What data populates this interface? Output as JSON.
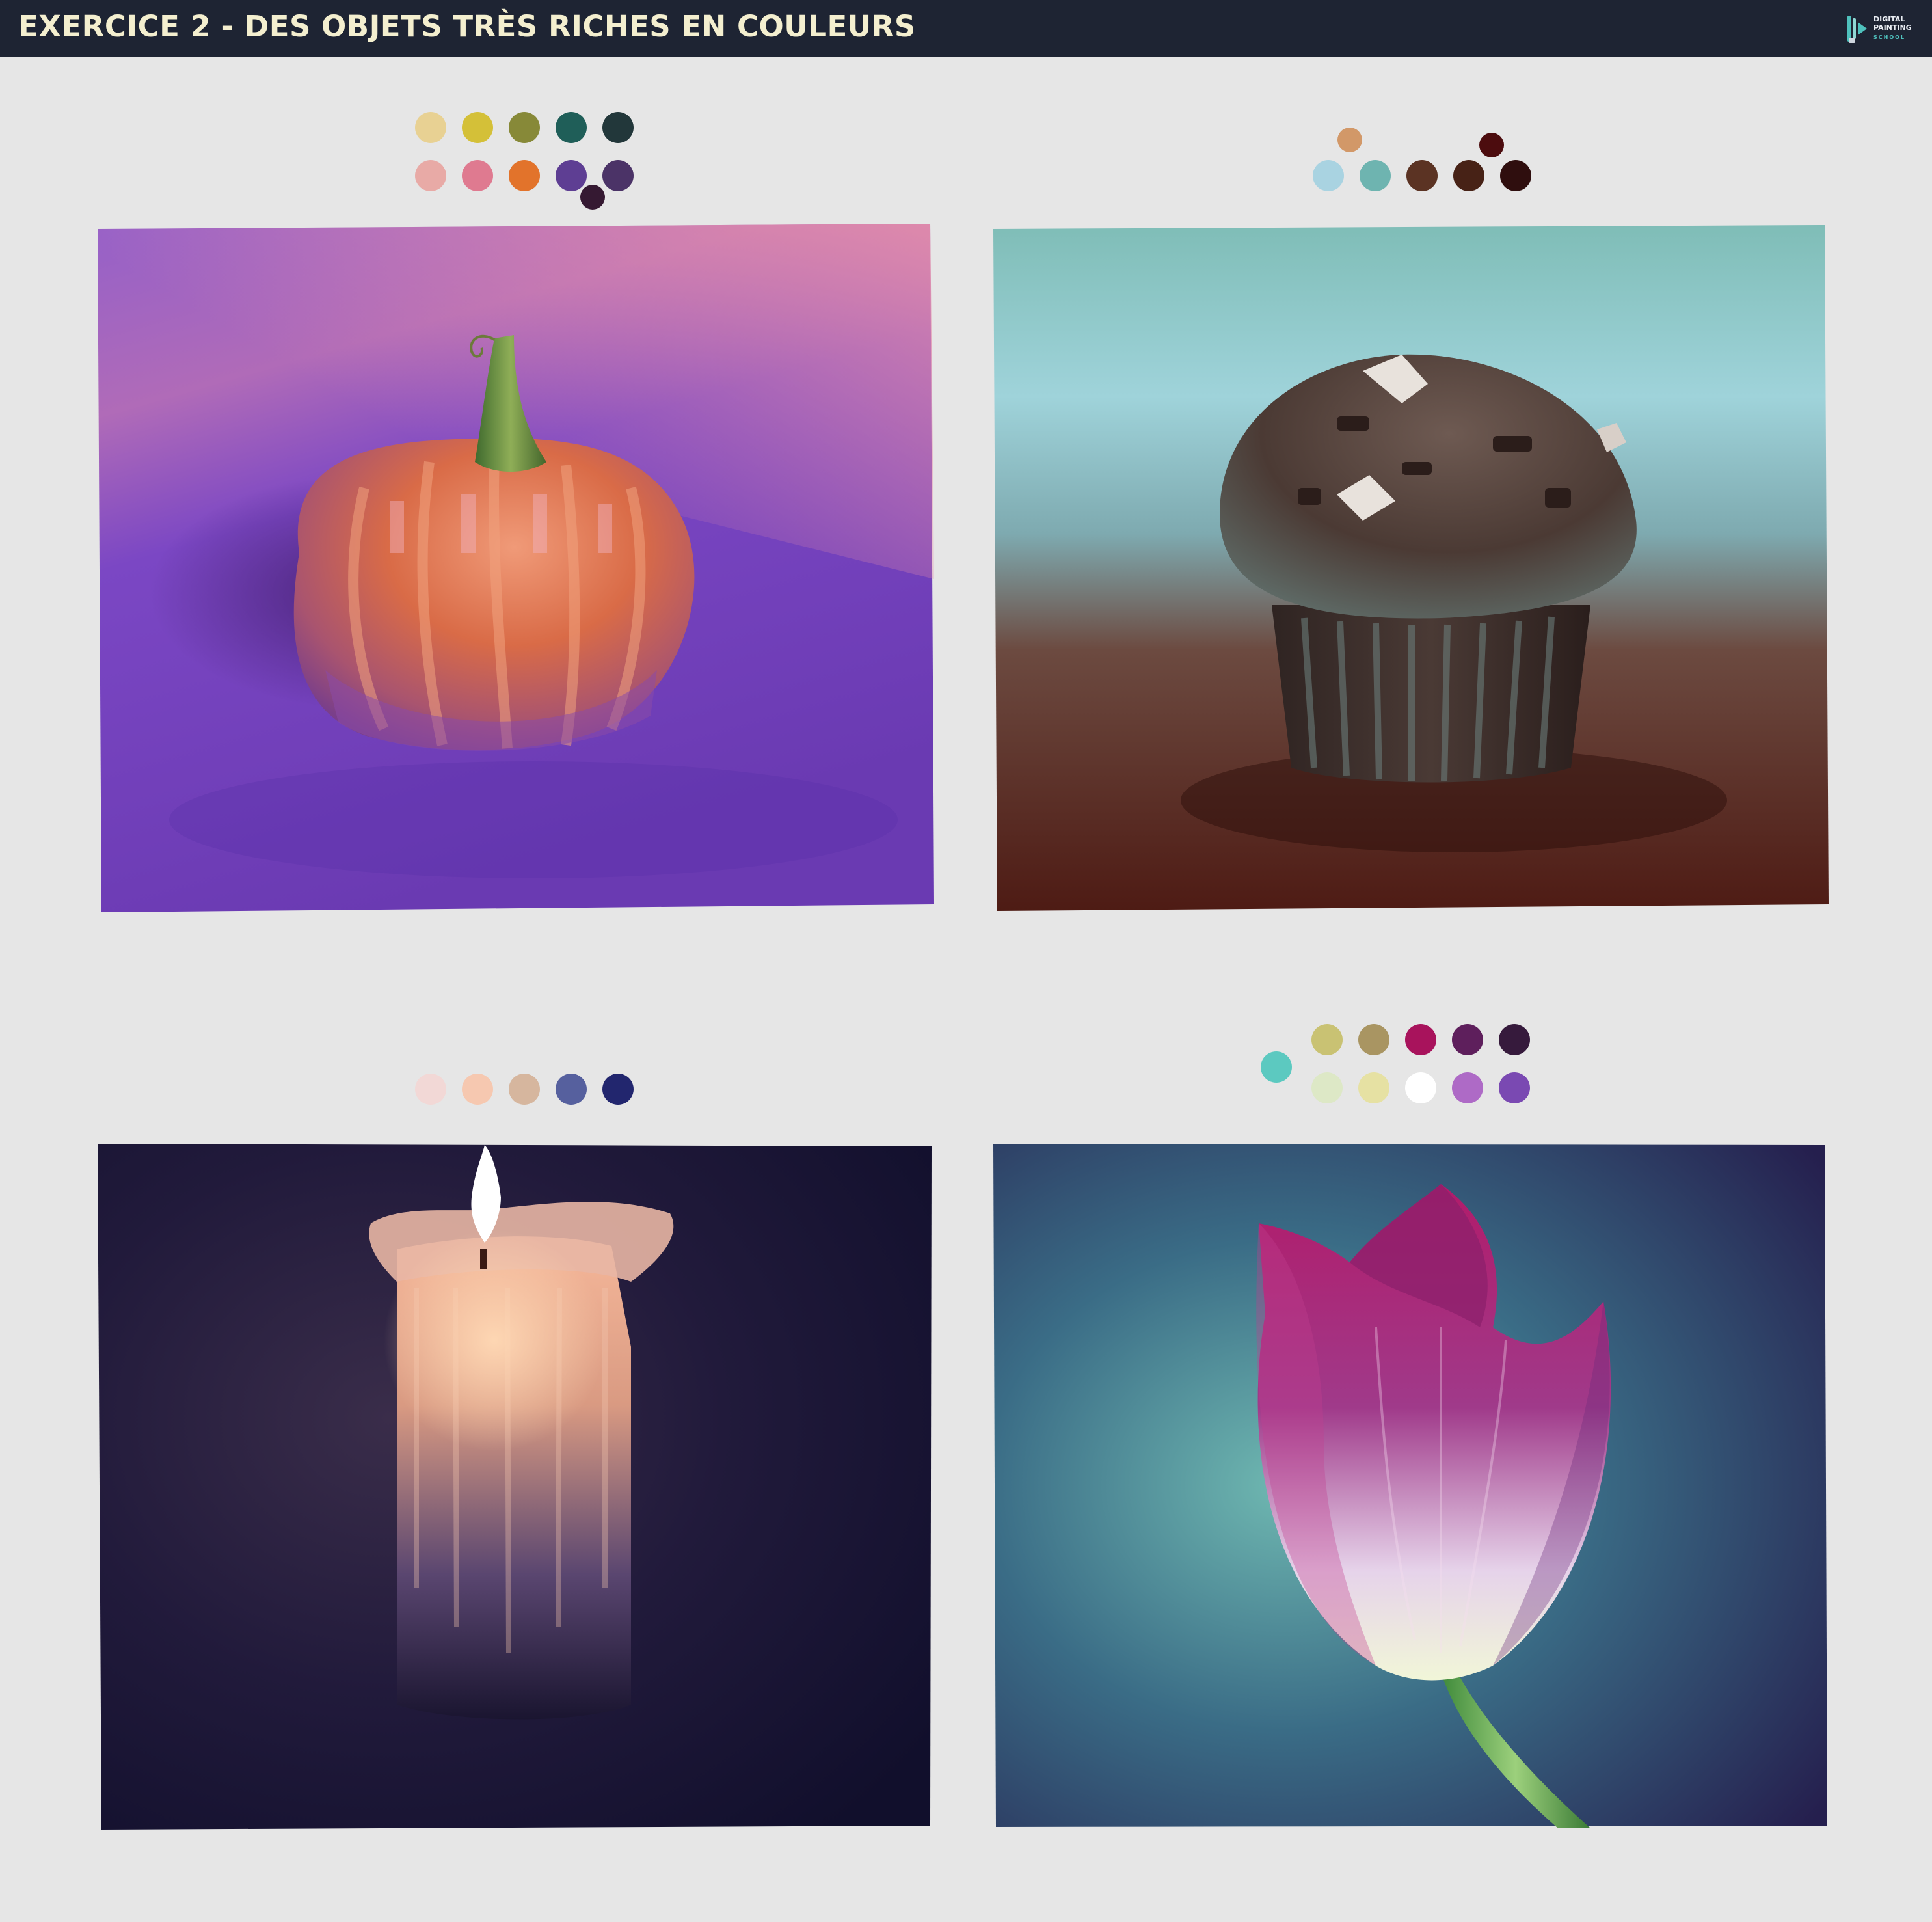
{
  "header": {
    "title": "EXERCICE 2 - DES OBJETS TRÈS RICHES EN COULEURS",
    "logo_line1": "DIGITAL",
    "logo_line2": "PAINTING",
    "logo_line3": "SCHOOL",
    "background_color": "#1e2433",
    "title_color": "#f4efcf"
  },
  "paintings": [
    {
      "subject": "pumpkin",
      "palette": [
        "#e8d193",
        "#d4c038",
        "#878938",
        "#1f5e58",
        "#22373a",
        "#e8aaa6",
        "#df7a90",
        "#e2732b",
        "#5e3e93",
        "#4b3367",
        "#351932"
      ]
    },
    {
      "subject": "muffin",
      "palette": [
        "#d29868",
        "#a9d3e1",
        "#6eb4b0",
        "#5b3323",
        "#472216",
        "#4c0c0e",
        "#2f0e0e"
      ]
    },
    {
      "subject": "candle",
      "palette": [
        "#f2d8d6",
        "#f6c8b0",
        "#d6b69e",
        "#56609e",
        "#22266e"
      ]
    },
    {
      "subject": "tulip",
      "palette": [
        "#5cc9c0",
        "#c9c273",
        "#a99562",
        "#a8135c",
        "#5e1f5c",
        "#361a3c",
        "#dde8c6",
        "#e6e1a3",
        "#ffffff",
        "#ae6ac6",
        "#7a49b2"
      ]
    }
  ]
}
